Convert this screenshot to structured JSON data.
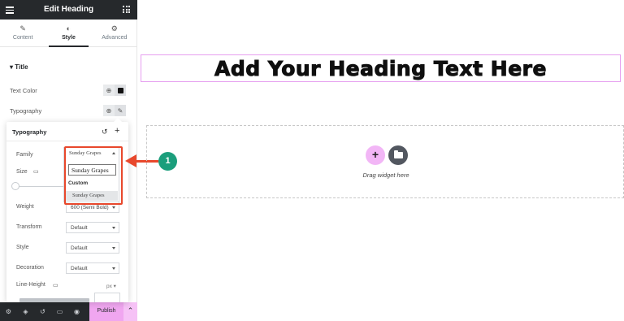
{
  "topbar": {
    "title": "Edit Heading"
  },
  "tabs": [
    {
      "label": "Content",
      "icon": "pencil-icon"
    },
    {
      "label": "Style",
      "icon": "half-circle-icon"
    },
    {
      "label": "Advanced",
      "icon": "gear-icon"
    }
  ],
  "section": {
    "title": "Title"
  },
  "style_rows": {
    "text_color": "Text Color",
    "typography": "Typography"
  },
  "popover": {
    "title": "Typography",
    "family_label": "Family",
    "family_value": "Sunday Grapes",
    "search_value": "Sunday Grapes",
    "group_label": "Custom",
    "option": "Sunday Grapes",
    "size_label": "Size",
    "weight_label": "Weight",
    "weight_value": "600 (Semi Bold)",
    "transform_label": "Transform",
    "transform_value": "Default",
    "style_label": "Style",
    "style_value": "Default",
    "decoration_label": "Decoration",
    "decoration_value": "Default",
    "line_height_label": "Line-Height",
    "line_height_unit": "px"
  },
  "footer": {
    "publish": "Publish"
  },
  "canvas": {
    "heading": "Add Your Heading Text Here",
    "drag_hint": "Drag widget here"
  },
  "callout": {
    "number": "1"
  },
  "colors": {
    "accent_pink": "#f0a6f0",
    "callout_red": "#e8482c",
    "badge_green": "#1b9e7c",
    "dark": "#26292c"
  }
}
